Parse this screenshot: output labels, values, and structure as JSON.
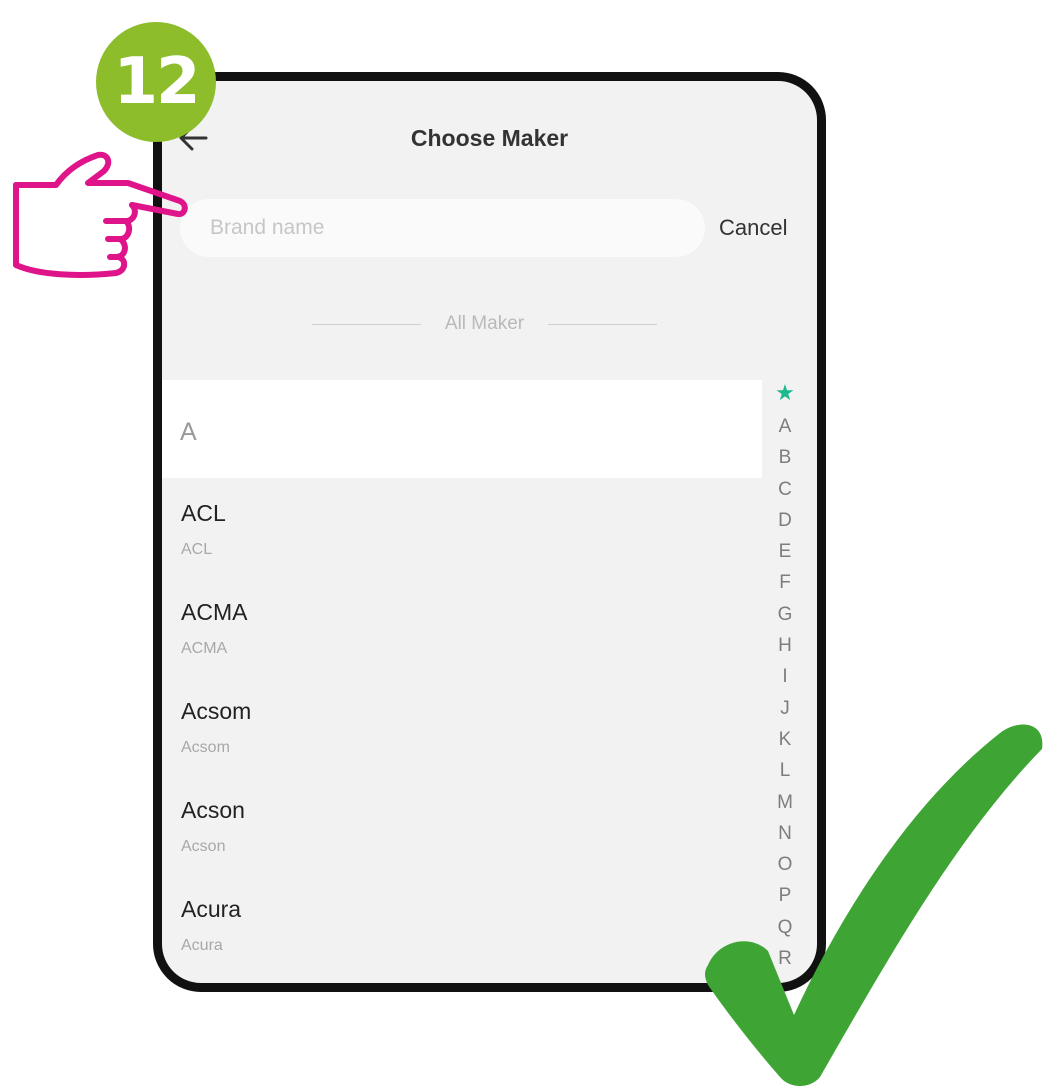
{
  "step": {
    "number": "12",
    "badge_color": "#8dbd2a"
  },
  "header": {
    "title": "Choose Maker",
    "back_icon": "arrow-left-icon"
  },
  "search": {
    "placeholder": "Brand name",
    "value": "",
    "cancel_label": "Cancel"
  },
  "section_divider": {
    "label": "All Maker"
  },
  "section_header": {
    "letter": "A"
  },
  "makers": [
    {
      "name": "ACL",
      "subtitle": "ACL"
    },
    {
      "name": "ACMA",
      "subtitle": "ACMA"
    },
    {
      "name": "Acsom",
      "subtitle": "Acsom"
    },
    {
      "name": "Acson",
      "subtitle": "Acson"
    },
    {
      "name": "Acura",
      "subtitle": "Acura"
    }
  ],
  "index_bar": {
    "star_icon": "star-icon",
    "star_color": "#1bb98d",
    "letters": [
      "A",
      "B",
      "C",
      "D",
      "E",
      "F",
      "G",
      "H",
      "I",
      "J",
      "K",
      "L",
      "M",
      "N",
      "O",
      "P",
      "Q",
      "R"
    ]
  },
  "annotations": {
    "pointer": "pointing-hand-icon",
    "pointer_color": "#e0148a",
    "check": "checkmark-icon",
    "check_color": "#3ea535"
  }
}
